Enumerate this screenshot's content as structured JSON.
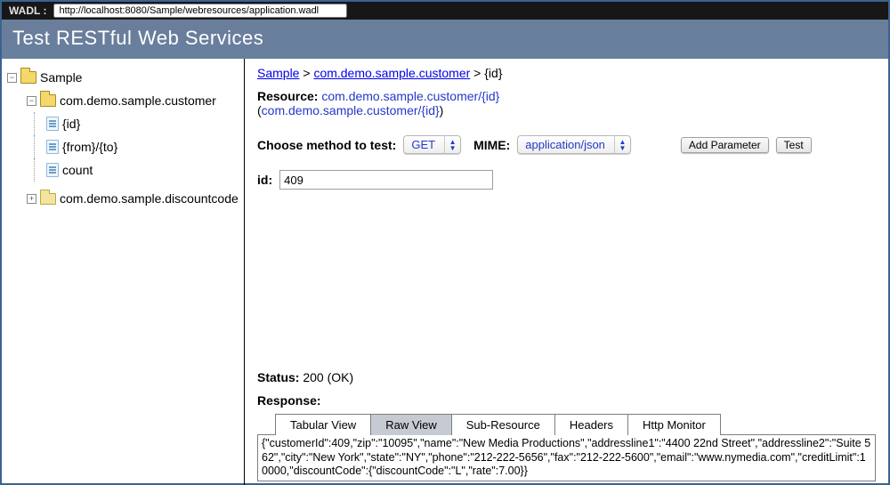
{
  "wadl": {
    "label": "WADL :",
    "url": "http://localhost:8080/Sample/webresources/application.wadl"
  },
  "title": "Test RESTful Web Services",
  "tree": {
    "root": {
      "label": "Sample",
      "toggle": "−",
      "children": [
        {
          "label": "com.demo.sample.customer",
          "toggle": "−",
          "items": [
            "{id}",
            "{from}/{to}",
            "count"
          ]
        },
        {
          "label": "com.demo.sample.discountcode",
          "toggle": "+"
        }
      ]
    }
  },
  "breadcrumb": [
    "Sample",
    "com.demo.sample.customer",
    "{id}"
  ],
  "resource": {
    "label": "Resource:",
    "path": "com.demo.sample.customer/{id}",
    "paren": "com.demo.sample.customer/{id}"
  },
  "method": {
    "choose_label": "Choose method to test:",
    "value": "GET",
    "mime_label": "MIME:",
    "mime_value": "application/json",
    "add_param_btn": "Add Parameter",
    "test_btn": "Test"
  },
  "id_param": {
    "label": "id:",
    "value": "409"
  },
  "status": {
    "label": "Status:",
    "value": "200 (OK)"
  },
  "response_label": "Response:",
  "tabs": [
    "Tabular View",
    "Raw View",
    "Sub-Resource",
    "Headers",
    "Http Monitor"
  ],
  "active_tab": "Raw View",
  "raw_response": "{\"customerId\":409,\"zip\":\"10095\",\"name\":\"New Media Productions\",\"addressline1\":\"4400 22nd Street\",\"addressline2\":\"Suite 562\",\"city\":\"New York\",\"state\":\"NY\",\"phone\":\"212-222-5656\",\"fax\":\"212-222-5600\",\"email\":\"www.nymedia.com\",\"creditLimit\":10000,\"discountCode\":{\"discountCode\":\"L\",\"rate\":7.00}}"
}
